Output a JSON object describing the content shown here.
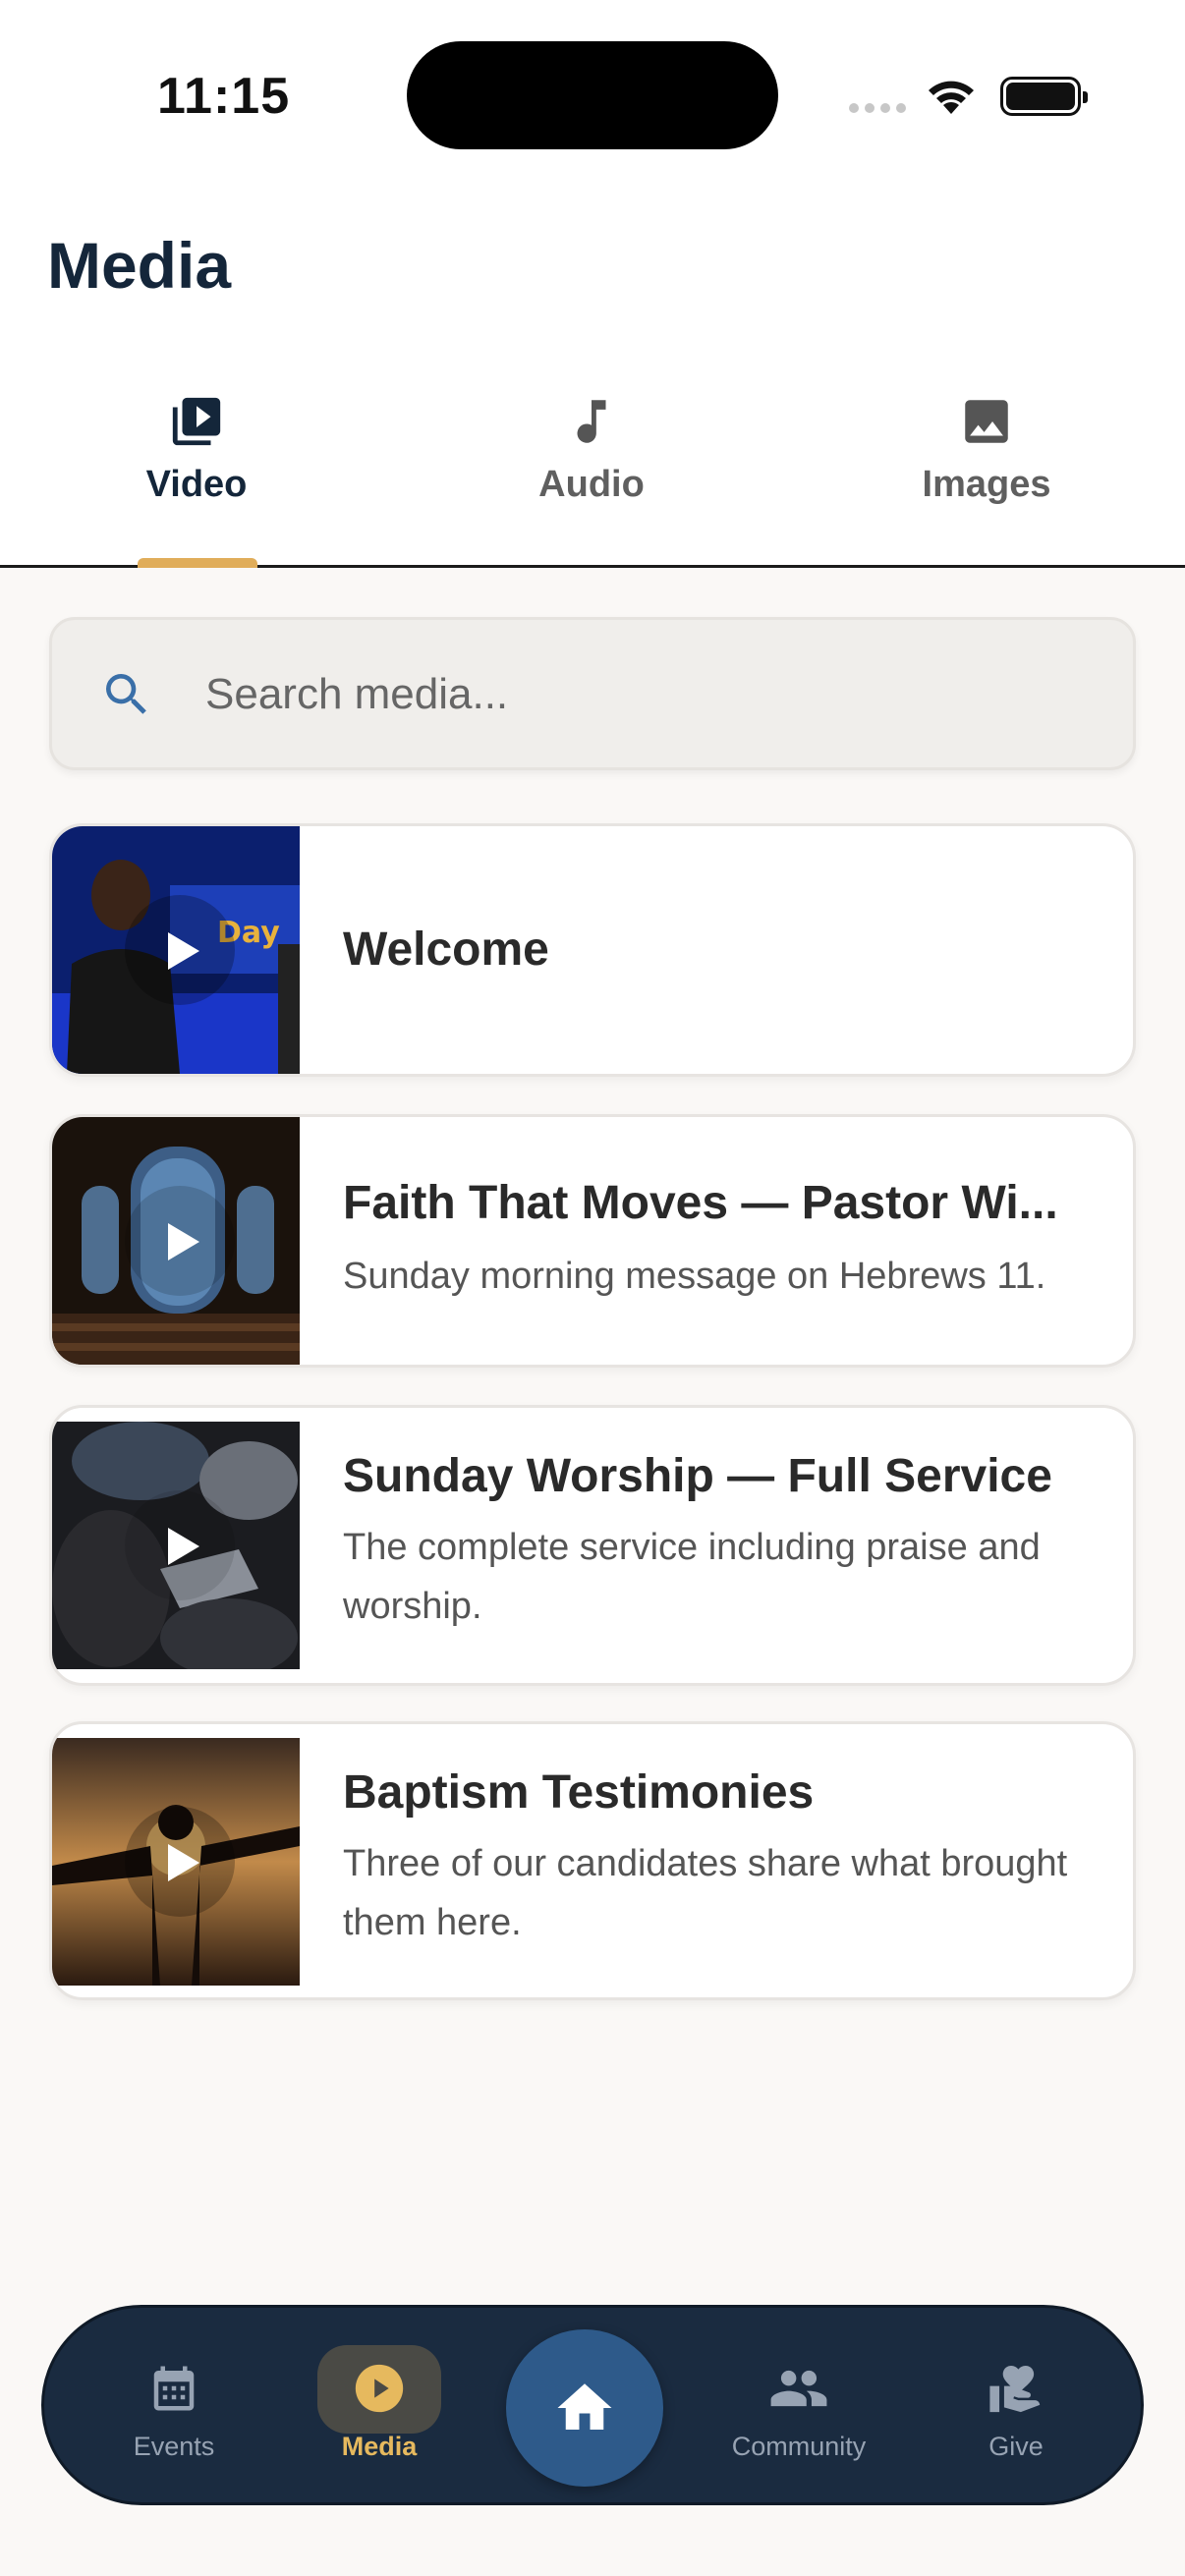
{
  "status_bar": {
    "time": "11:15"
  },
  "header": {
    "title": "Media"
  },
  "tabs": [
    {
      "label": "Video",
      "icon": "video-library-icon",
      "active": true
    },
    {
      "label": "Audio",
      "icon": "music-note-icon",
      "active": false
    },
    {
      "label": "Images",
      "icon": "image-icon",
      "active": false
    }
  ],
  "search": {
    "placeholder": "Search media...",
    "value": "",
    "icon": "search-icon"
  },
  "media_items": [
    {
      "title": "Welcome",
      "description": ""
    },
    {
      "title": "Faith That Moves — Pastor Wi...",
      "description": "Sunday morning message on Hebrews 11."
    },
    {
      "title": "Sunday Worship — Full Service",
      "description": "The complete service including praise and worship."
    },
    {
      "title": "Baptism Testimonies",
      "description": "Three of our candidates share what brought them here."
    }
  ],
  "bottom_nav": {
    "items": [
      {
        "label": "Events",
        "icon": "calendar-icon",
        "active": false
      },
      {
        "label": "Media",
        "icon": "play-circle-icon",
        "active": true
      },
      {
        "label": "Community",
        "icon": "people-icon",
        "active": false
      },
      {
        "label": "Give",
        "icon": "hand-heart-icon",
        "active": false
      }
    ],
    "home_icon": "home-icon"
  },
  "colors": {
    "accent": "#e0ad5a",
    "title": "#14263a",
    "nav_background": "#1a2b40",
    "home_button": "#2e5a8a",
    "search_icon": "#3a6fa8"
  }
}
